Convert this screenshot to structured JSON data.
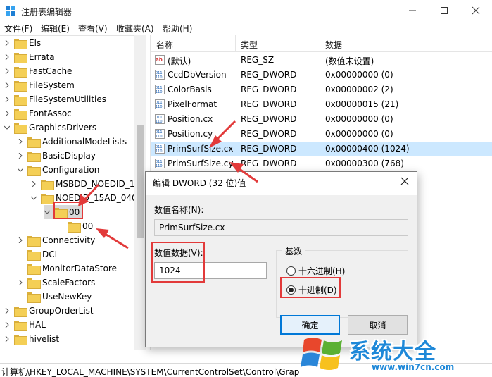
{
  "window": {
    "title": "注册表编辑器"
  },
  "menu": [
    "文件(F)",
    "编辑(E)",
    "查看(V)",
    "收藏夹(A)",
    "帮助(H)"
  ],
  "tree": [
    {
      "label": "Els",
      "expander": ">"
    },
    {
      "label": "Errata",
      "expander": ">"
    },
    {
      "label": "FastCache",
      "expander": ">"
    },
    {
      "label": "FileSystem",
      "expander": ">"
    },
    {
      "label": "FileSystemUtilities",
      "expander": ">"
    },
    {
      "label": "FontAssoc",
      "expander": ">"
    },
    {
      "label": "GraphicsDrivers",
      "expander": "v"
    },
    {
      "label": "AdditionalModeLists",
      "expander": ">"
    },
    {
      "label": "BasicDisplay",
      "expander": ">"
    },
    {
      "label": "Configuration",
      "expander": "v"
    },
    {
      "label": "MSBDD_NOEDID_1",
      "expander": ">"
    },
    {
      "label": "NOEDID_15AD_040",
      "expander": "v"
    },
    {
      "label": "00",
      "expander": "v"
    },
    {
      "label": "00",
      "expander": ""
    },
    {
      "label": "Connectivity",
      "expander": ">"
    },
    {
      "label": "DCI",
      "expander": ""
    },
    {
      "label": "MonitorDataStore",
      "expander": ""
    },
    {
      "label": "ScaleFactors",
      "expander": ">"
    },
    {
      "label": "UseNewKey",
      "expander": ""
    },
    {
      "label": "GroupOrderList",
      "expander": ">"
    },
    {
      "label": "HAL",
      "expander": ">"
    },
    {
      "label": "hivelist",
      "expander": ">"
    }
  ],
  "values_header": {
    "name": "名称",
    "type": "类型",
    "data": "数据"
  },
  "values": [
    {
      "name": "(默认)",
      "type": "REG_SZ",
      "data": "(数值未设置)",
      "icon": "string-value-icon"
    },
    {
      "name": "CcdDbVersion",
      "type": "REG_DWORD",
      "data": "0x00000000 (0)",
      "icon": "binary-value-icon"
    },
    {
      "name": "ColorBasis",
      "type": "REG_DWORD",
      "data": "0x00000002 (2)",
      "icon": "binary-value-icon"
    },
    {
      "name": "PixelFormat",
      "type": "REG_DWORD",
      "data": "0x00000015 (21)",
      "icon": "binary-value-icon"
    },
    {
      "name": "Position.cx",
      "type": "REG_DWORD",
      "data": "0x00000000 (0)",
      "icon": "binary-value-icon"
    },
    {
      "name": "Position.cy",
      "type": "REG_DWORD",
      "data": "0x00000000 (0)",
      "icon": "binary-value-icon"
    },
    {
      "name": "PrimSurfSize.cx",
      "type": "REG_DWORD",
      "data": "0x00000400 (1024)",
      "icon": "binary-value-icon"
    },
    {
      "name": "PrimSurfSize.cy",
      "type": "REG_DWORD",
      "data": "0x00000300 (768)",
      "icon": "binary-value-icon"
    }
  ],
  "status": "计算机\\HKEY_LOCAL_MACHINE\\SYSTEM\\CurrentControlSet\\Control\\Grap",
  "dialog": {
    "title": "编辑 DWORD (32 位)值",
    "name_label": "数值名称(N):",
    "name_value": "PrimSurfSize.cx",
    "data_label": "数值数据(V):",
    "data_value": "1024",
    "base_label": "基数",
    "hex_label": "十六进制(H)",
    "dec_label": "十进制(D)",
    "ok": "确定",
    "cancel": "取消"
  },
  "watermark": {
    "brand": "系统大全",
    "url": "www.win7cn.com"
  },
  "colors": {
    "selection": "#cce8ff",
    "highlight": "#e23a3a",
    "accent": "#0078d7",
    "folder": "#f4cf56"
  }
}
